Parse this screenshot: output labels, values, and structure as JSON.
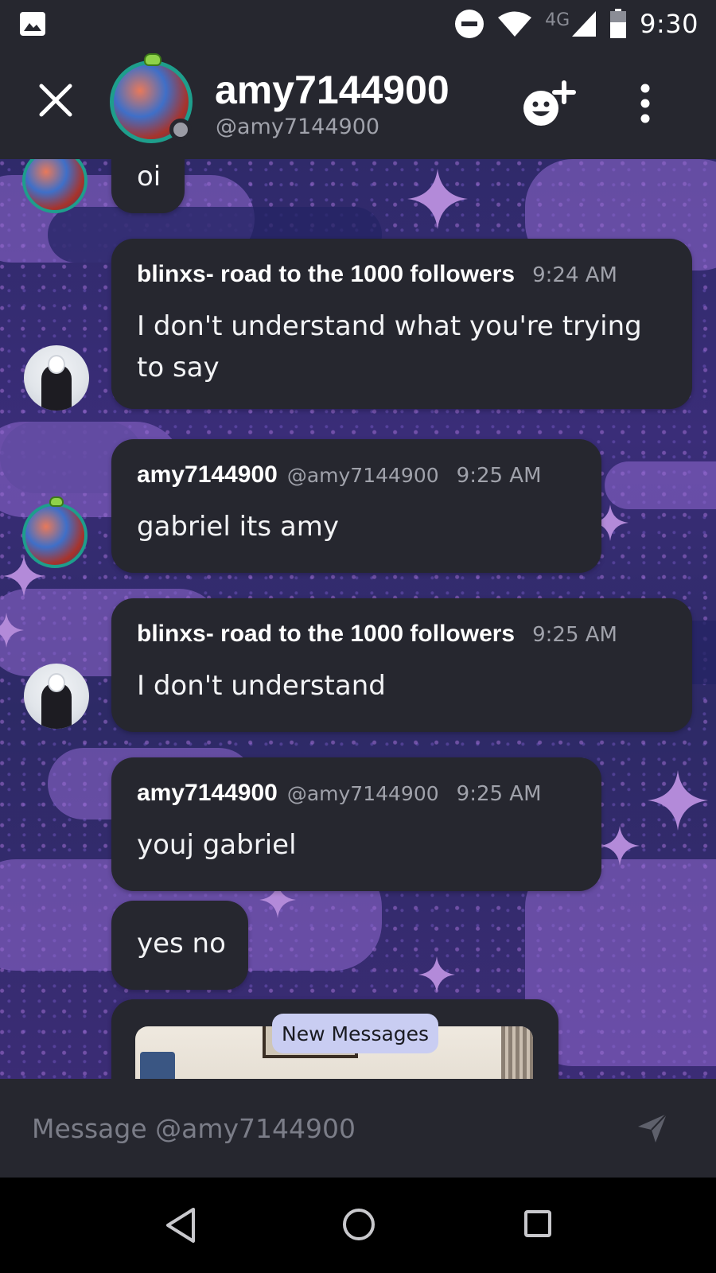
{
  "status_bar": {
    "time": "9:30",
    "network_label": "4G",
    "icons": [
      "image-icon",
      "do-not-disturb-icon",
      "wifi-icon",
      "signal-icon",
      "battery-icon"
    ]
  },
  "header": {
    "name": "amy7144900",
    "handle": "@amy7144900",
    "icons": [
      "close-icon",
      "add-friend-icon",
      "more-options-icon"
    ]
  },
  "messages": [
    {
      "kind": "continuation",
      "avatar": "amy",
      "text": "oi"
    },
    {
      "kind": "message",
      "avatar": "blinx",
      "author": "blinxs- road to the 1000 followers",
      "time": "9:24 AM",
      "lines": [
        "I don't understand what you're trying",
        "to say"
      ]
    },
    {
      "kind": "message",
      "avatar": "amy",
      "author": "amy7144900",
      "handle": "@amy7144900",
      "time": "9:25 AM",
      "text": "gabriel its amy"
    },
    {
      "kind": "message",
      "avatar": "blinx",
      "author": "blinxs- road to the 1000 followers",
      "time": "9:25 AM",
      "text": "I don't understand"
    },
    {
      "kind": "message",
      "avatar": "amy",
      "author": "amy7144900",
      "handle": "@amy7144900",
      "time": "9:25 AM",
      "text": "youj gabriel"
    },
    {
      "kind": "continuation",
      "avatar": "amy",
      "text": "yes no"
    }
  ],
  "new_messages_label": "New Messages",
  "composer": {
    "placeholder": "Message @amy7144900"
  },
  "colors": {
    "bar_bg": "#26272f",
    "bubble_bg": "#26272f",
    "muted_text": "#a0a2ab",
    "avatar_ring": "#1e9e8c",
    "pill_bg": "#c9cdf2"
  }
}
